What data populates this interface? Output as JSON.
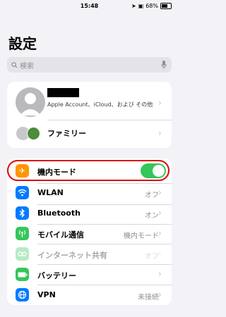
{
  "status_bar": {
    "time": "15:48",
    "battery": "68%"
  },
  "page_title": "設定",
  "search": {
    "placeholder": "検索"
  },
  "profile": {
    "account_text": "Apple Account、iCloud、および その他",
    "family_label": "ファミリー"
  },
  "rows": [
    {
      "label": "機内モード",
      "value": "",
      "icon": "airplane-icon",
      "color": "#ff9500",
      "toggle_on": true
    },
    {
      "label": "WLAN",
      "value": "オフ",
      "icon": "wifi-icon",
      "color": "#007aff"
    },
    {
      "label": "Bluetooth",
      "value": "オン",
      "icon": "bluetooth-icon",
      "color": "#007aff"
    },
    {
      "label": "モバイル通信",
      "value": "機内モード",
      "icon": "antenna-icon",
      "color": "#34c759"
    },
    {
      "label": "インターネット共有",
      "value": "オフ",
      "icon": "link-icon",
      "color": "#34c759"
    },
    {
      "label": "バッテリー",
      "value": "",
      "icon": "battery-icon",
      "color": "#34c759"
    },
    {
      "label": "VPN",
      "value": "未接続",
      "icon": "globe-icon",
      "color": "#007aff"
    }
  ]
}
